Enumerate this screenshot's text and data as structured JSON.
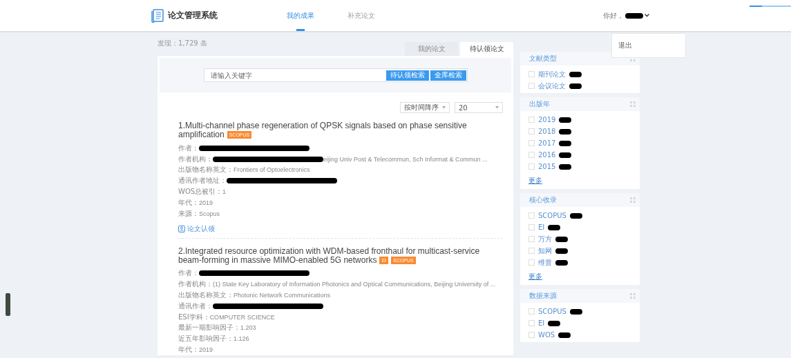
{
  "header": {
    "app_title": "论文管理系统",
    "nav": [
      {
        "label": "我的成果",
        "selected": true
      },
      {
        "label": "补充论文",
        "selected": false
      }
    ],
    "greeting": "你好，",
    "user_menu": {
      "items": [
        "退出"
      ]
    }
  },
  "results_count": "发现：1,729 条",
  "view_tabs": [
    {
      "label": "我的论文",
      "selected": false
    },
    {
      "label": "待认领论文",
      "selected": true
    }
  ],
  "search": {
    "placeholder": "请输入关键字",
    "buttons": [
      "待认领检索",
      "全库检索"
    ]
  },
  "sort": {
    "order": "按时间降序",
    "page_size": "20"
  },
  "papers": [
    {
      "title": "1.Multi-channel phase regeneration of QPSK signals based on phase sensitive amplification",
      "tags": [
        "SCOPUS"
      ],
      "fields": [
        {
          "label": "作者：",
          "redacted": true
        },
        {
          "label": "作者机构：",
          "redacted": true,
          "value": "eijing Univ Post & Telecommun, Sch Informat & Commun ..."
        },
        {
          "label": "出版物名称英文：",
          "value": "Frontiers of Optoelectronics"
        },
        {
          "label": "通讯作者地址：",
          "redacted": true
        },
        {
          "label": "WOS总被引：",
          "value": "1"
        },
        {
          "label": "年代：",
          "value": "2019"
        },
        {
          "label": "来源：",
          "value": " Scopus"
        }
      ],
      "action": "论文认领"
    },
    {
      "title": "2.Integrated resource optimization with WDM-based fronthaul for multicast-service beam-forming in massive MIMO-enabled 5G networks",
      "tags": [
        "EI",
        "SCOPUS"
      ],
      "fields": [
        {
          "label": "作者：",
          "redacted": true
        },
        {
          "label": "作者机构：",
          "value": "(1) State Key Laboratory of Information Photonics and Optical Communications, Beijing University of ..."
        },
        {
          "label": "出版物名称英文：",
          "value": "Photonic Network Communications"
        },
        {
          "label": "通讯作者：",
          "redacted": true
        },
        {
          "label": "ESI学科：",
          "value": "COMPUTER SCIENCE"
        },
        {
          "label": "最新一期影响因子：",
          "value": "1.203"
        },
        {
          "label": "近五年影响因子：",
          "value": "1.126"
        },
        {
          "label": "年代：",
          "value": "2019"
        }
      ]
    }
  ],
  "filters": [
    {
      "title": "文献类型",
      "items": [
        {
          "label": "期刊论文",
          "checked": false
        },
        {
          "label": "会议论文",
          "checked": false
        }
      ]
    },
    {
      "title": "出版年",
      "items": [
        {
          "label": "2019",
          "checked": false
        },
        {
          "label": "2018",
          "checked": false
        },
        {
          "label": "2017",
          "checked": false
        },
        {
          "label": "2016",
          "checked": false
        },
        {
          "label": "2015",
          "checked": false
        }
      ],
      "more": "更多"
    },
    {
      "title": "核心收录",
      "items": [
        {
          "label": "SCOPUS",
          "checked": false
        },
        {
          "label": "EI",
          "checked": false
        },
        {
          "label": "万方",
          "checked": false
        },
        {
          "label": "知网",
          "checked": false
        },
        {
          "label": "维普",
          "checked": false
        }
      ],
      "more": "更多"
    },
    {
      "title": "数据来源",
      "items": [
        {
          "label": "SCOPUS",
          "checked": false
        },
        {
          "label": "EI",
          "checked": false
        },
        {
          "label": "WOS",
          "checked": false
        }
      ]
    }
  ]
}
